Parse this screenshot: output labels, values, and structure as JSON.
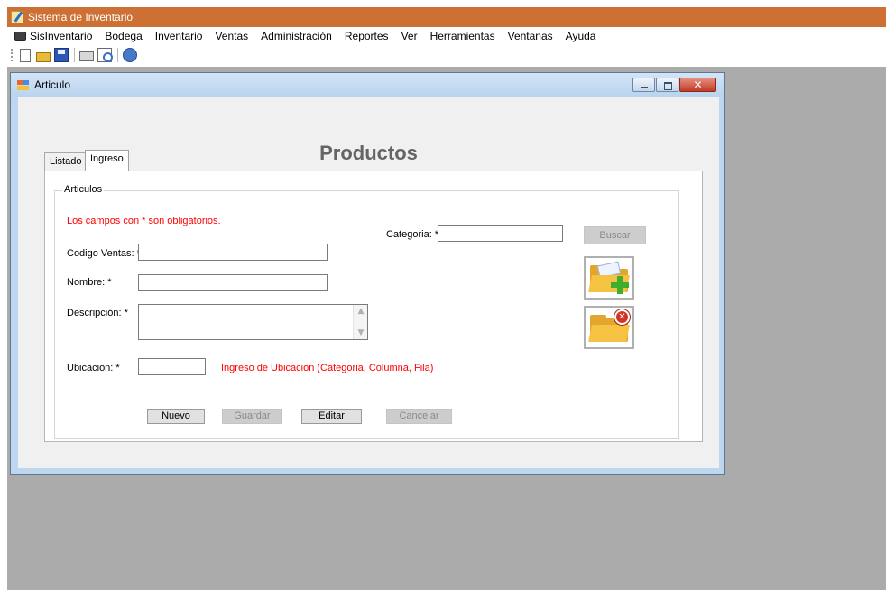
{
  "app": {
    "title": "Sistema de Inventario"
  },
  "menu": [
    "SisInventario",
    "Bodega",
    "Inventario",
    "Ventas",
    "Administración",
    "Reportes",
    "Ver",
    "Herramientas",
    "Ventanas",
    "Ayuda"
  ],
  "toolbar": {
    "icons": [
      "new-document-icon",
      "open-folder-icon",
      "save-icon",
      "print-icon",
      "print-preview-icon",
      "help-icon"
    ]
  },
  "window": {
    "title": "Articulo"
  },
  "form": {
    "page_title": "Productos",
    "tabs": [
      "Listado",
      "Ingreso"
    ],
    "active_tab": "Ingreso",
    "group_title": "Articulos",
    "required_note": "Los campos con * son obligatorios.",
    "labels": {
      "categoria": "Categoria: *",
      "codigo": "Codigo Ventas: *",
      "nombre": "Nombre: *",
      "descripcion": "Descripción: *",
      "ubicacion": "Ubicacion: *"
    },
    "values": {
      "categoria": "",
      "codigo": "",
      "nombre": "",
      "descripcion": "",
      "ubicacion": ""
    },
    "ubicacion_hint": "Ingreso de Ubicacion (Categoria, Columna, Fila)",
    "buttons": {
      "buscar": "Buscar",
      "nuevo": "Nuevo",
      "guardar": "Guardar",
      "editar": "Editar",
      "cancelar": "Cancelar"
    },
    "icon_buttons": [
      "add-folder-icon",
      "delete-folder-icon"
    ]
  },
  "colors": {
    "title_bar": "#cd7034",
    "mdi_background": "#ababab",
    "required_text": "#ff0000",
    "page_title": "#656565"
  }
}
